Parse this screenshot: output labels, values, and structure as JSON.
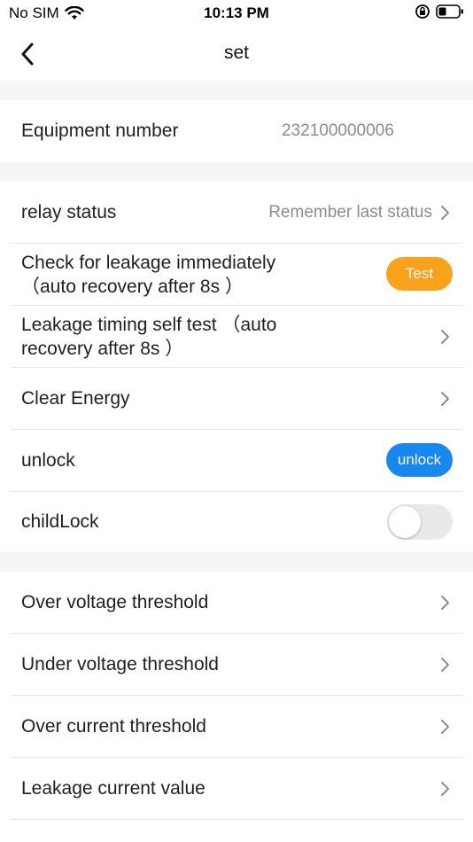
{
  "status_bar": {
    "carrier": "No SIM",
    "time": "10:13 PM"
  },
  "nav": {
    "title": "set"
  },
  "equipment": {
    "label": "Equipment number",
    "value": "232100000006"
  },
  "relay": {
    "label": "relay status",
    "value": "Remember last status"
  },
  "leak_check": {
    "label_line1": "Check for leakage immediately",
    "label_line2": "（auto recovery after 8s ）",
    "button": "Test"
  },
  "leak_timing": {
    "label_line1": "Leakage timing self test （auto",
    "label_line2": "recovery after 8s ）"
  },
  "clear_energy": {
    "label": "Clear Energy"
  },
  "unlock": {
    "label": "unlock",
    "button": "unlock"
  },
  "child_lock": {
    "label": "childLock",
    "enabled": false
  },
  "thresholds": [
    {
      "label": "Over voltage threshold"
    },
    {
      "label": "Under voltage threshold"
    },
    {
      "label": "Over current threshold"
    },
    {
      "label": "Leakage current value"
    }
  ],
  "colors": {
    "test_button": "#f9a21b",
    "unlock_button": "#1788f0",
    "section_gap": "#f5f5f5",
    "secondary_text": "#8c8c8c"
  }
}
